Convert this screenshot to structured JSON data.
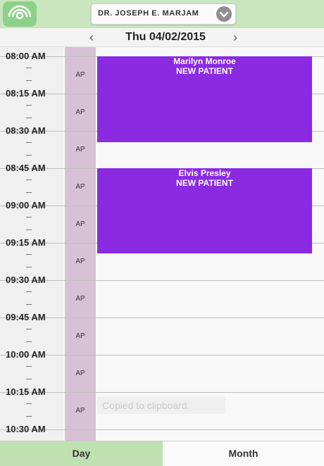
{
  "header": {
    "doctor_name": "DR. JOSEPH E. MARJAM"
  },
  "date_nav": {
    "date_label": "Thu 04/02/2015"
  },
  "times": [
    "08:00 AM",
    "08:15 AM",
    "08:30 AM",
    "08:45 AM",
    "09:00 AM",
    "09:15 AM",
    "09:30 AM",
    "09:45 AM",
    "10:00 AM",
    "10:15 AM",
    "10:30 AM"
  ],
  "ap_column_label": "AP",
  "appointments": [
    {
      "name": "Marilyn Monroe",
      "type": "NEW PATIENT",
      "color": "#8a2be2"
    },
    {
      "name": "Elvis Presley",
      "type": "NEW PATIENT",
      "color": "#8a2be2"
    }
  ],
  "toast": "Copied to clipboard.",
  "tabs": {
    "day": "Day",
    "month": "Month"
  },
  "colors": {
    "header_bg": "#c9e6bf",
    "ap_col": "#d7c2d5",
    "appointment": "#8a2be2",
    "active_tab": "#bfe1b2"
  },
  "icons": {
    "logo": "signal-arcs-icon",
    "doctor_dropdown": "chevron-down-icon",
    "prev": "chevron-left-icon",
    "next": "chevron-right-icon"
  }
}
